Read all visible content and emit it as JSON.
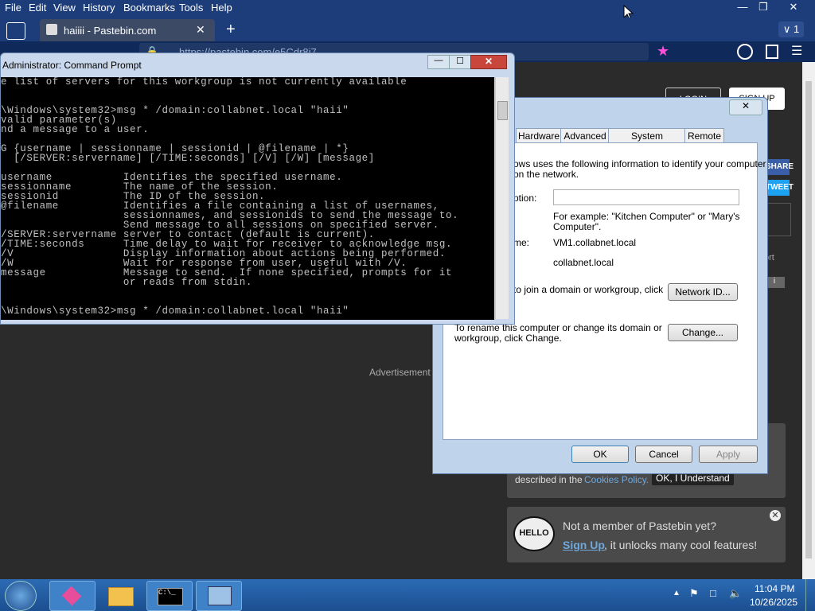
{
  "menubar": {
    "items": [
      "File",
      "Edit",
      "View",
      "History",
      "Bookmarks",
      "Tools",
      "Help"
    ]
  },
  "window_controls": {
    "tab_count": "1"
  },
  "browser_tab": {
    "title": "haiiii - Pastebin.com"
  },
  "address_bar": {
    "url": "https://pastebin.com/e5Cdr8i7"
  },
  "pastebin": {
    "login_label": "LOGIN",
    "signup_label": "SIGN UP",
    "share_label": "SHARE",
    "tweet_label": "TWEET",
    "advertisement": "Advertisement",
    "cookie_text": "described in the",
    "cookie_link": "Cookies Policy.",
    "cookie_button": "OK, I Understand",
    "hello_badge": "HELLO",
    "member_prompt": "Not a member of Pastebin yet?",
    "signup_link": "Sign Up",
    "signup_text": ", it unlocks many cool features!",
    "report_label": "ort",
    "i_label": "i"
  },
  "cmd": {
    "title": "Administrator: Command Prompt",
    "lines": [
      "e list of servers for this workgroup is not currently available",
      "",
      "",
      "\\Windows\\system32>msg * /domain:collabnet.local \"haii\"",
      "valid parameter(s)",
      "nd a message to a user.",
      "",
      "G {username | sessionname | sessionid | @filename | *}",
      "  [/SERVER:servername] [/TIME:seconds] [/V] [/W] [message]",
      "",
      "username           Identifies the specified username.",
      "sessionname        The name of the session.",
      "sessionid          The ID of the session.",
      "@filename          Identifies a file containing a list of usernames,",
      "                   sessionnames, and sessionids to send the message to.",
      "                   Send message to all sessions on specified server.",
      "/SERVER:servername server to contact (default is current).",
      "/TIME:seconds      Time delay to wait for receiver to acknowledge msg.",
      "/V                 Display information about actions being performed.",
      "/W                 Wait for response from user, useful with /V.",
      "message            Message to send.  If none specified, prompts for it",
      "                   or reads from stdin.",
      "",
      "",
      "\\Windows\\system32>msg * /domain:collabnet.local \"haii\""
    ]
  },
  "sysprop": {
    "tabs": [
      "Hardware",
      "Advanced",
      "System Protection",
      "Remote"
    ],
    "intro": "ows uses the following information to identify your computer\non the network.",
    "description_label": "ption:",
    "description_value": "",
    "example": "For example: \"Kitchen Computer\" or \"Mary's\nComputer\".",
    "fullname_label": "me:",
    "fullname_value": "VM1.collabnet.local",
    "domain_value": "collabnet.local",
    "network_text": "to join a domain or workgroup, click",
    "network_button": "Network ID...",
    "rename_text": "To rename this computer or change its domain or\nworkgroup, click Change.",
    "change_button": "Change...",
    "ok": "OK",
    "cancel": "Cancel",
    "apply": "Apply"
  },
  "taskbar": {
    "time": "11:04 PM",
    "date": "10/26/2025"
  }
}
